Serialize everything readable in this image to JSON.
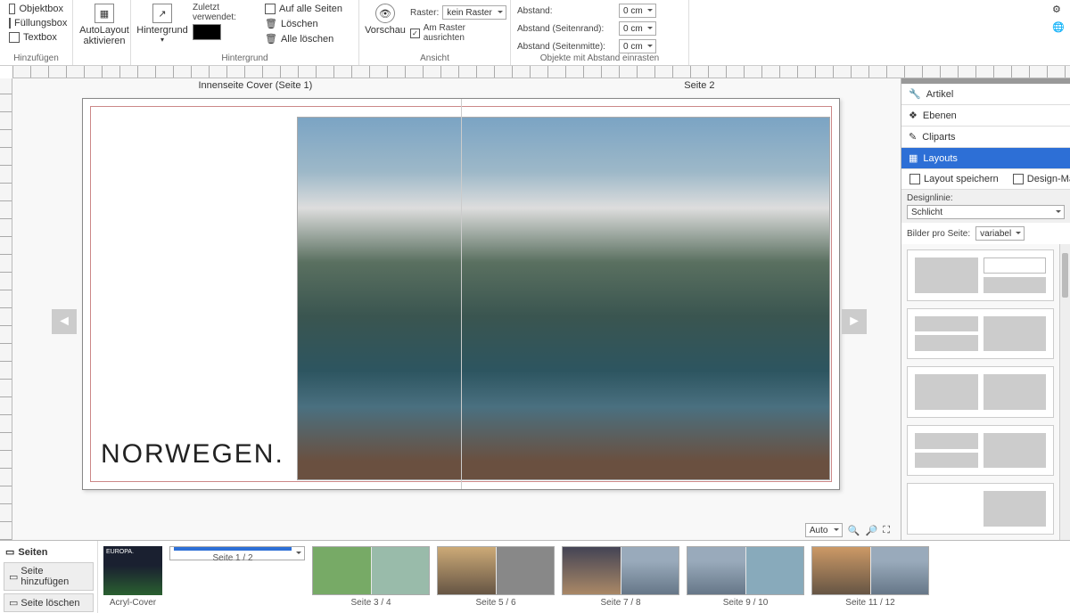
{
  "toolbar": {
    "add": {
      "label": "Hinzufügen",
      "objektbox": "Objektbox",
      "fuellungsbox": "Füllungsbox",
      "textbox": "Textbox"
    },
    "autolayout": {
      "line1": "AutoLayout",
      "line2": "aktivieren"
    },
    "hintergrund": {
      "group": "Hintergrund",
      "btn": "Hintergrund",
      "recent": "Zuletzt verwendet:",
      "all_pages": "Auf alle Seiten",
      "delete": "Löschen",
      "delete_all": "Alle löschen"
    },
    "ansicht": {
      "group": "Ansicht",
      "vorschau": "Vorschau",
      "raster_lbl": "Raster:",
      "raster_val": "kein Raster",
      "snap": "Am Raster ausrichten"
    },
    "abstand": {
      "group": "Objekte mit Abstand einrasten",
      "abstand": "Abstand:",
      "rand": "Abstand (Seitenrand):",
      "mitte": "Abstand (Seitenmitte):",
      "val": "0 cm"
    }
  },
  "canvas": {
    "page_left": "Innenseite Cover (Seite 1)",
    "page_right": "Seite 2",
    "title": "NORWEGEN."
  },
  "zoom": {
    "mode": "Auto"
  },
  "right": {
    "artikel": "Artikel",
    "ebenen": "Ebenen",
    "cliparts": "Cliparts",
    "layouts": "Layouts",
    "save": "Layout speichern",
    "manager": "Design-Manager",
    "designlinie_lbl": "Designlinie:",
    "designlinie_val": "Schlicht",
    "bps_lbl": "Bilder pro Seite:",
    "bps_val": "variabel"
  },
  "bottom": {
    "title": "Seiten",
    "add": "Seite hinzufügen",
    "del": "Seite löschen",
    "cover": "Acryl-Cover",
    "cover_txt": "EUROPA.",
    "pages": [
      "Seite 1 / 2",
      "Seite 3 / 4",
      "Seite 5 / 6",
      "Seite 7 / 8",
      "Seite 9 / 10",
      "Seite 11 / 12"
    ]
  }
}
